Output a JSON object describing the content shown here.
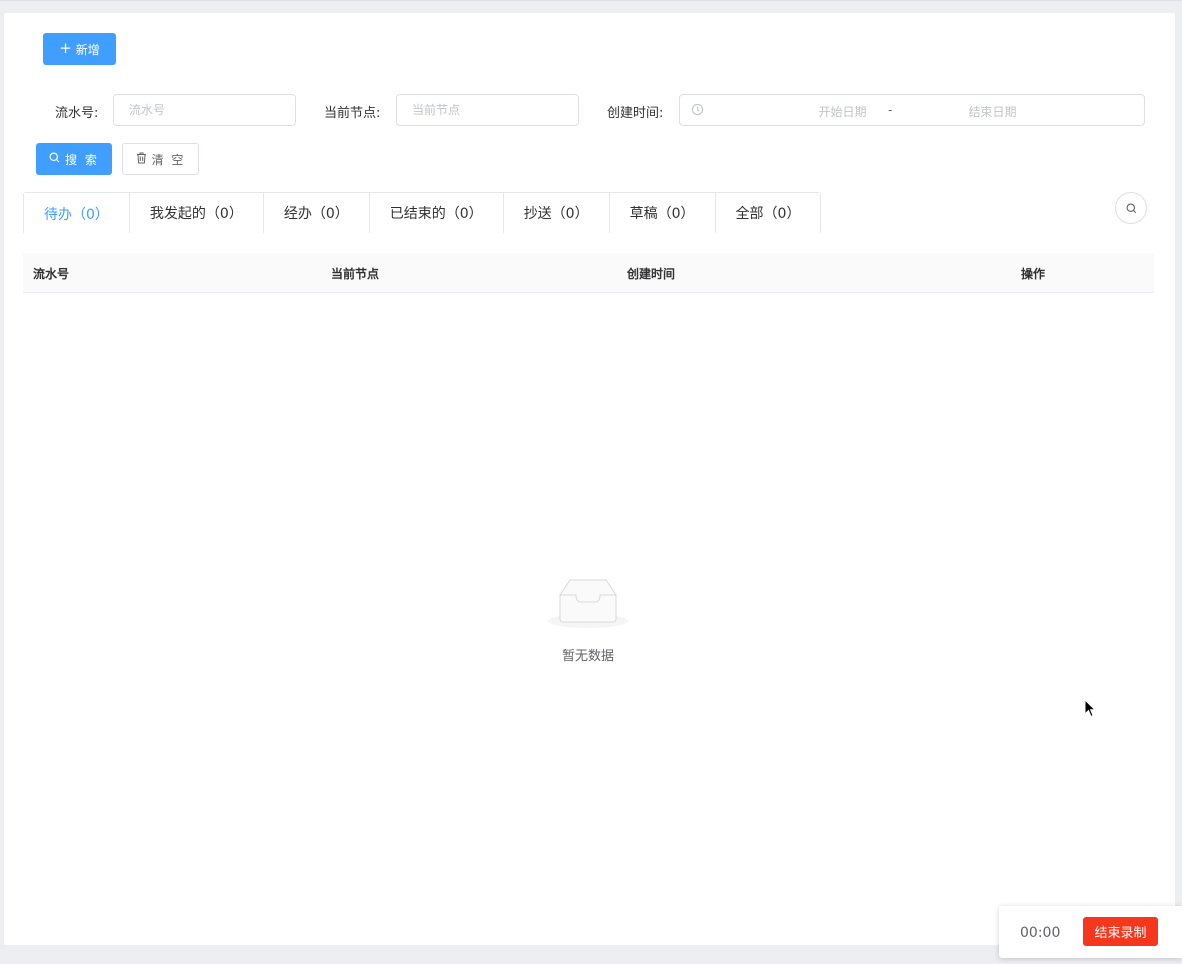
{
  "toolbar": {
    "add_label": "新增"
  },
  "filters": {
    "serial_label": "流水号:",
    "serial_placeholder": "流水号",
    "node_label": "当前节点:",
    "node_placeholder": "当前节点",
    "created_label": "创建时间:",
    "start_placeholder": "开始日期",
    "range_separator": "-",
    "end_placeholder": "结束日期",
    "search_label": "搜 索",
    "clear_label": "清 空"
  },
  "tabs": [
    {
      "label": "待办（0）",
      "active": true
    },
    {
      "label": "我发起的（0）",
      "active": false
    },
    {
      "label": "经办（0）",
      "active": false
    },
    {
      "label": "已结束的（0）",
      "active": false
    },
    {
      "label": "抄送（0）",
      "active": false
    },
    {
      "label": "草稿（0）",
      "active": false
    },
    {
      "label": "全部（0）",
      "active": false
    }
  ],
  "table": {
    "columns": [
      "流水号",
      "当前节点",
      "创建时间",
      "操作"
    ],
    "rows": [],
    "empty_text": "暂无数据"
  },
  "recorder": {
    "time": "00:00",
    "stop_label": "结束录制"
  },
  "colors": {
    "primary": "#409eff",
    "record_red": "#f5371e"
  },
  "icons": {
    "add": "plus-icon",
    "search": "search-icon",
    "clear": "trash-icon",
    "date": "clock-icon",
    "empty": "inbox-empty-icon"
  }
}
